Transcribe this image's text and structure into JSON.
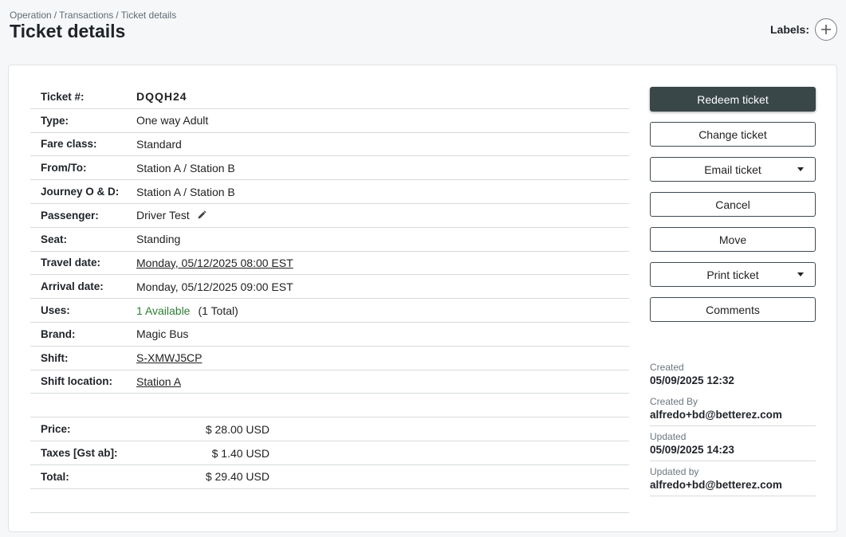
{
  "breadcrumb": [
    "Operation",
    "Transactions",
    "Ticket details"
  ],
  "page_title": "Ticket details",
  "labels": {
    "text": "Labels:"
  },
  "details": {
    "ticket_no": {
      "label": "Ticket #:",
      "value": "DQQH24"
    },
    "type": {
      "label": "Type:",
      "value": "One way Adult"
    },
    "fare_class": {
      "label": "Fare class:",
      "value": "Standard"
    },
    "from_to": {
      "label": "From/To:",
      "value": "Station A / Station B"
    },
    "journey": {
      "label": "Journey O & D:",
      "value": "Station A / Station B"
    },
    "passenger": {
      "label": "Passenger:",
      "value": "Driver Test"
    },
    "seat": {
      "label": "Seat:",
      "value": "Standing"
    },
    "travel_date": {
      "label": "Travel date:",
      "value": "Monday, 05/12/2025 08:00 EST"
    },
    "arrival_date": {
      "label": "Arrival date:",
      "value": "Monday, 05/12/2025 09:00 EST"
    },
    "uses": {
      "label": "Uses:",
      "available": "1 Available",
      "total": "(1 Total)"
    },
    "brand": {
      "label": "Brand:",
      "value": "Magic Bus"
    },
    "shift": {
      "label": "Shift:",
      "value": "S-XMWJ5CP"
    },
    "shift_location": {
      "label": "Shift location:",
      "value": "Station A"
    }
  },
  "pricing": {
    "price": {
      "label": "Price:",
      "value": "$ 28.00 USD"
    },
    "taxes": {
      "label": "Taxes [Gst ab]:",
      "value": "$ 1.40 USD"
    },
    "total": {
      "label": "Total:",
      "value": "$ 29.40 USD"
    }
  },
  "actions": {
    "redeem": "Redeem ticket",
    "change": "Change ticket",
    "email": "Email ticket",
    "cancel": "Cancel",
    "move": "Move",
    "print": "Print ticket",
    "comments": "Comments"
  },
  "meta": {
    "created": {
      "label": "Created",
      "value": "05/09/2025 12:32"
    },
    "created_by": {
      "label": "Created By",
      "value": "alfredo+bd@betterez.com"
    },
    "updated": {
      "label": "Updated",
      "value": "05/09/2025 14:23"
    },
    "updated_by": {
      "label": "Updated by",
      "value": "alfredo+bd@betterez.com"
    }
  },
  "colors": {
    "primary_button": "#3a4749",
    "available_text": "#2e7d32",
    "background": "#f6f7f8"
  },
  "icons": {
    "add_label": "plus-icon",
    "passenger_edit": "pencil-icon",
    "dropdown": "caret-down-icon"
  }
}
